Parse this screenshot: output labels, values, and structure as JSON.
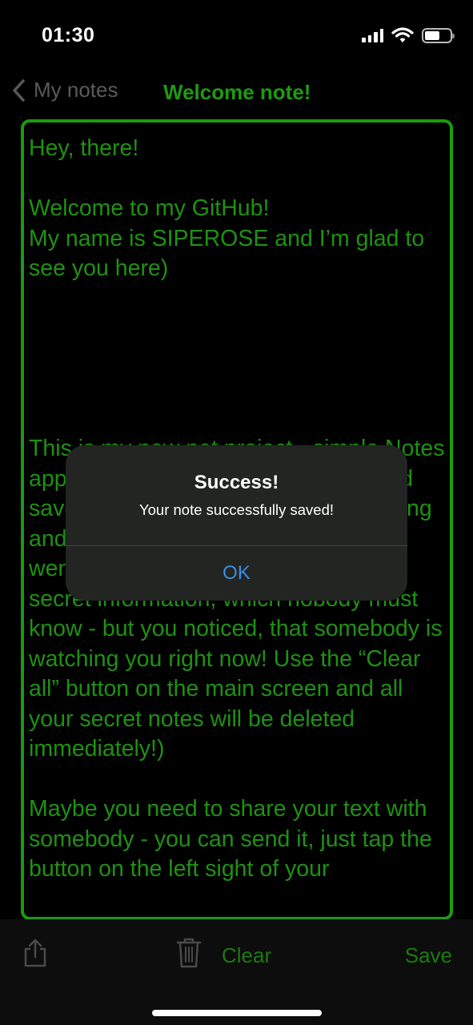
{
  "status_bar": {
    "time": "01:30",
    "icons": [
      "cellular-signal-icon",
      "wifi-icon",
      "battery-icon"
    ]
  },
  "nav": {
    "back_label": "My notes",
    "title": "Welcome note!"
  },
  "note": {
    "text": "Hey, there!\n\nWelcome to my GitHub!\nMy name is SIPEROSE and I’m glad to see you here)\n\n\n\n\n\nThis is my new pet project - simple Notes application, where you can create and save your notes. If you wrote something and then understood, that something went wrong, or you are writing some secret information, which nobody must know - but you noticed, that somebody is watching you right now! Use the “Clear all” button on the main screen and all your secret notes will be deleted immediately!)\n\nMaybe you need to share your text with somebody - you can send it, just tap the button on the left sight of your"
  },
  "toolbar": {
    "clear_label": "Clear",
    "save_label": "Save",
    "icons": [
      "share-icon",
      "trash-icon"
    ]
  },
  "alert": {
    "title": "Success!",
    "message": "Your note successfully saved!",
    "ok_label": "OK"
  },
  "colors": {
    "accent_green": "#1f9a12",
    "toolbar_green": "#1c7a10",
    "background": "#000000",
    "alert_background": "#232522",
    "alert_button_blue": "#3d8de3"
  }
}
